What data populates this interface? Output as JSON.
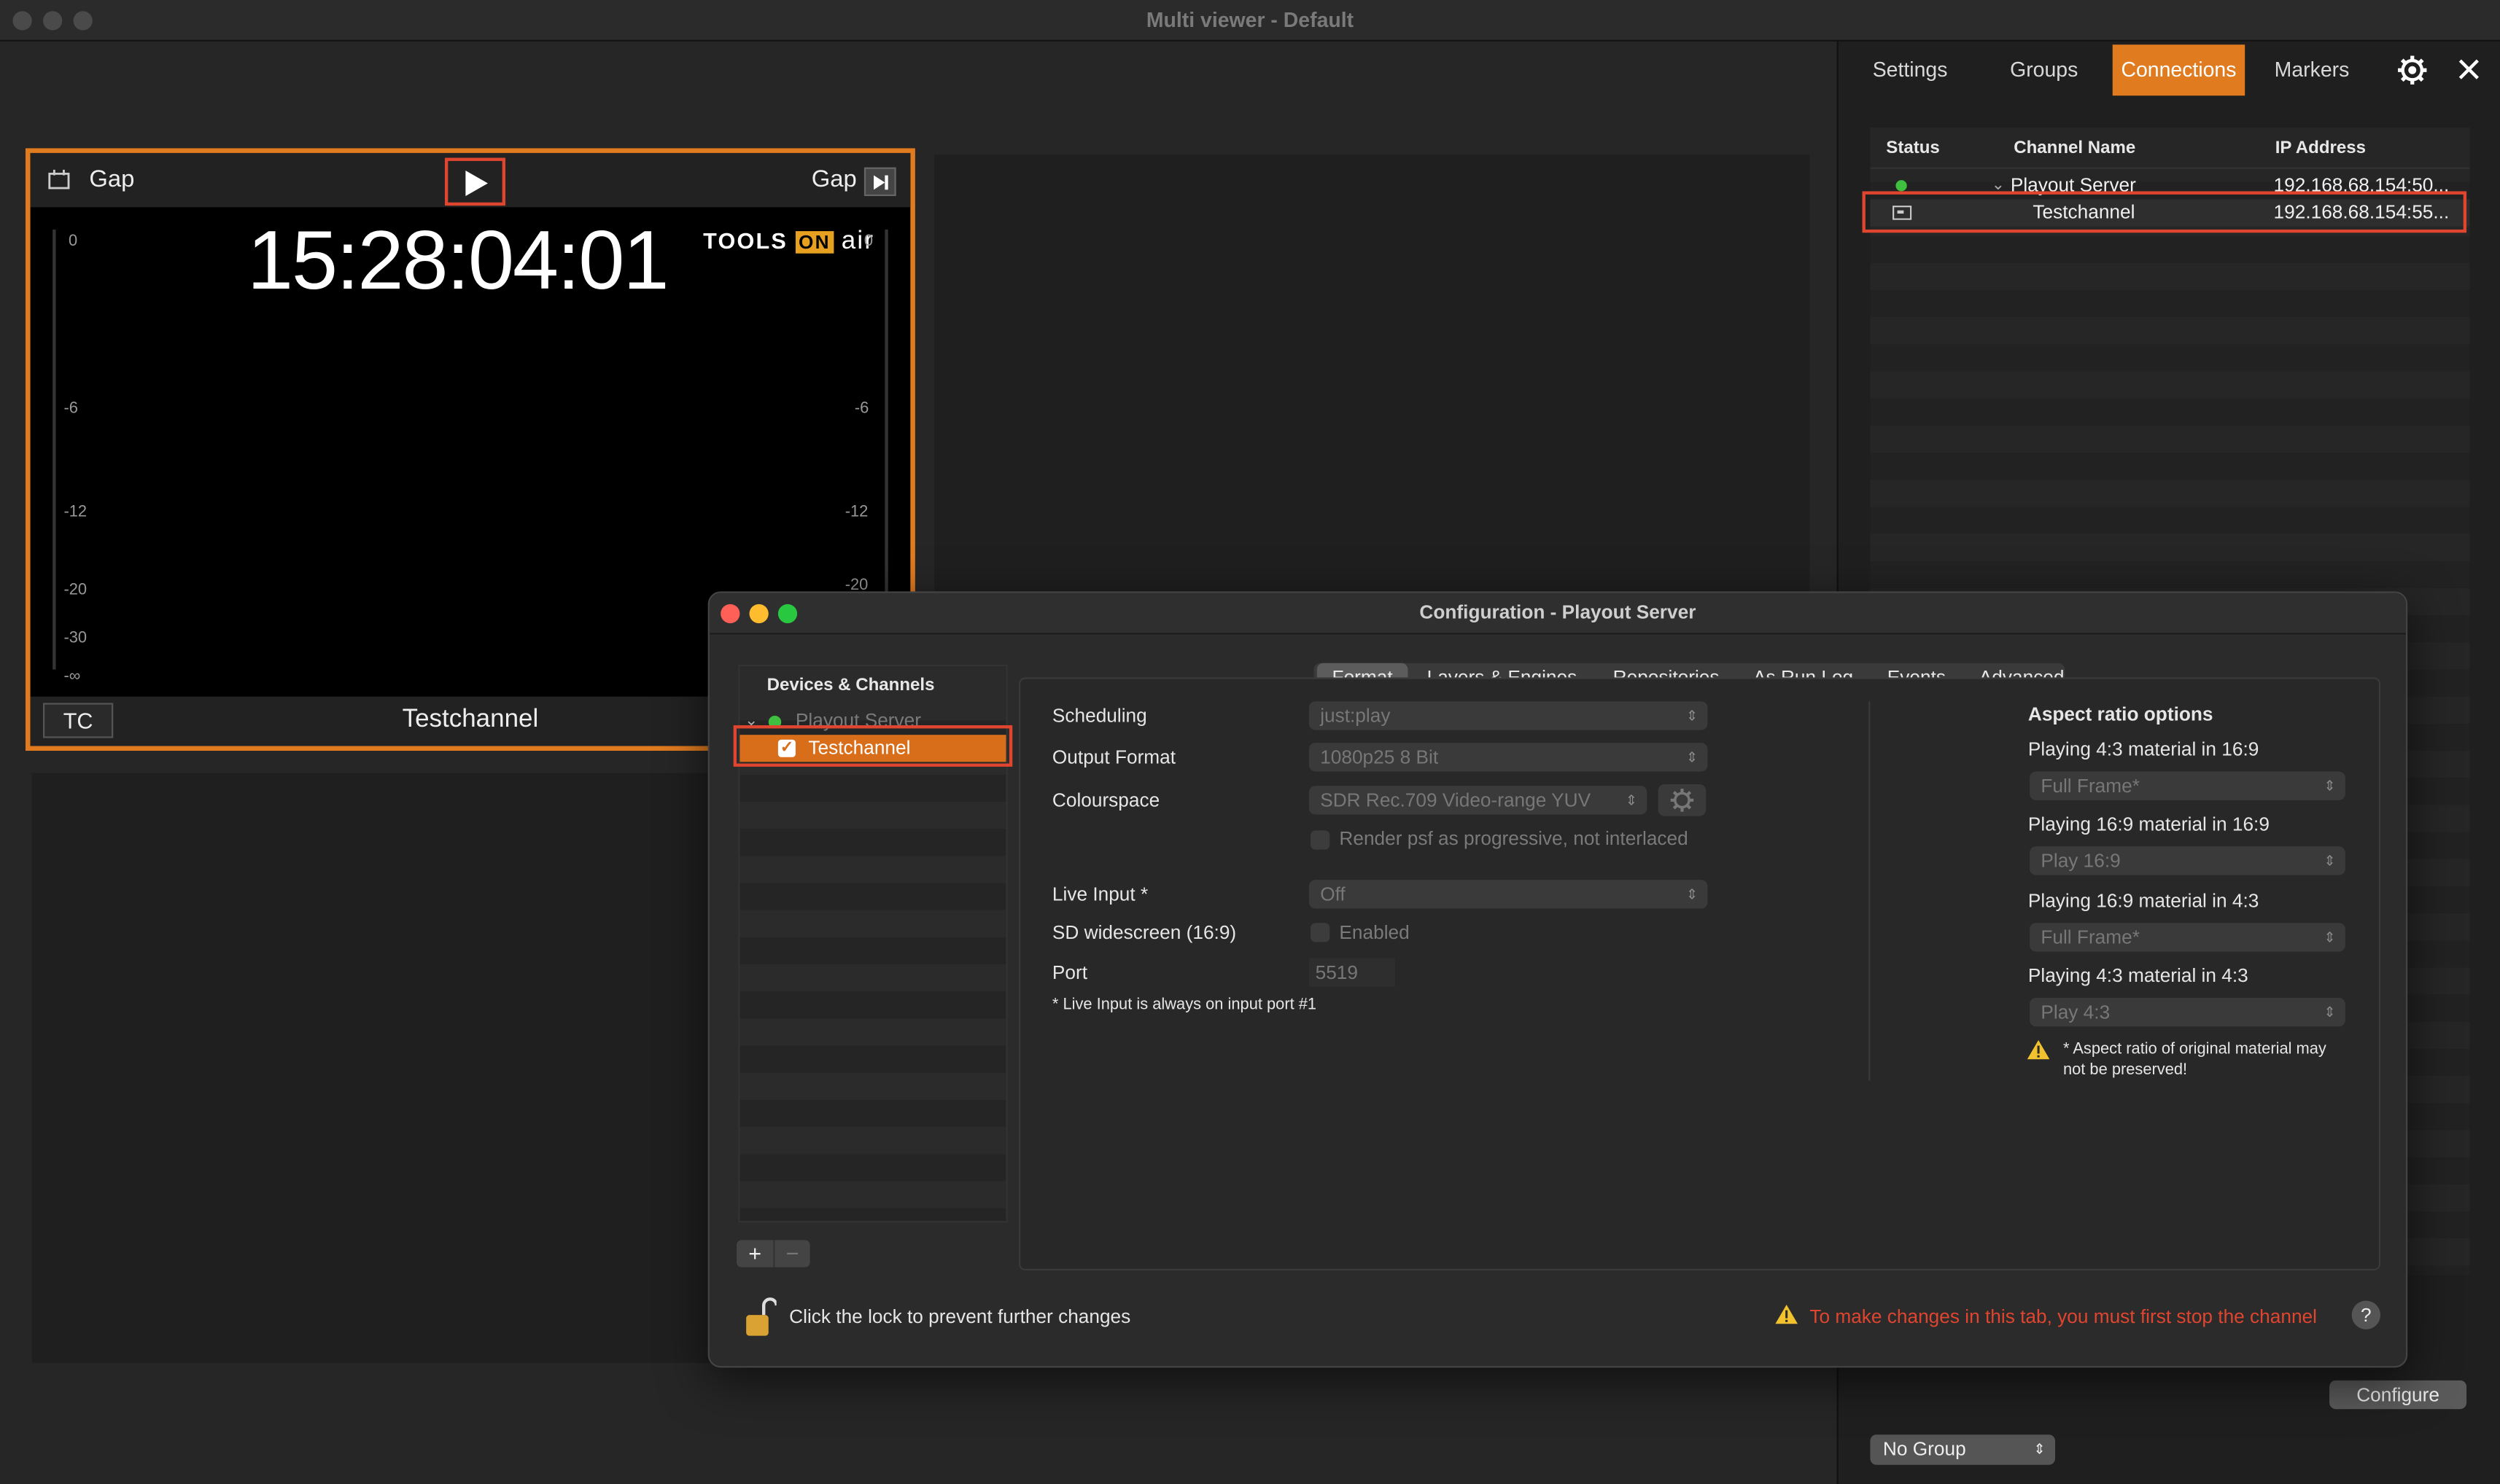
{
  "window": {
    "title": "Multi viewer - Default"
  },
  "tile": {
    "left_label": "Gap",
    "right_label": "Gap",
    "timecode": "15:28:04:01",
    "logo_tools": "TOOLS",
    "logo_on": "ON",
    "logo_air": "air",
    "meter_left": [
      "0",
      "-6",
      "-12",
      "-20",
      "-30",
      "-∞"
    ],
    "meter_right": [
      "0",
      "-6",
      "-12",
      "-20"
    ],
    "tc_label": "TC",
    "channel_name": "Testchannel"
  },
  "right_panel": {
    "tabs": [
      "Settings",
      "Groups",
      "Connections",
      "Markers"
    ],
    "active_tab": "Connections",
    "columns": [
      "Status",
      "Channel Name",
      "IP Address"
    ],
    "rows": [
      {
        "name": "Playout Server",
        "ip": "192.168.68.154:50...",
        "status_color": "#3fbf3f"
      },
      {
        "name": "Testchannel",
        "ip": "192.168.68.154:55..."
      }
    ],
    "configure_label": "Configure",
    "group_select": "No Group"
  },
  "dialog": {
    "title": "Configuration - Playout Server",
    "devices_header": "Devices & Channels",
    "device_parent": "Playout Server",
    "device_child": "Testchannel",
    "tabs": [
      "Format",
      "Layers & Engines",
      "Repositories",
      "As Run Log",
      "Events",
      "Advanced"
    ],
    "active_tab": "Format",
    "fields": {
      "scheduling_label": "Scheduling",
      "scheduling_value": "just:play",
      "output_label": "Output Format",
      "output_value": "1080p25 8 Bit",
      "colour_label": "Colourspace",
      "colour_value": "SDR Rec.709 Video-range YUV",
      "psf_label": "Render psf as progressive, not interlaced",
      "live_label": "Live Input *",
      "live_value": "Off",
      "sdwide_label": "SD widescreen (16:9)",
      "sdwide_value": "Enabled",
      "port_label": "Port",
      "port_value": "5519",
      "live_note": "* Live Input is always on input port #1"
    },
    "aspect": {
      "title": "Aspect ratio options",
      "items": [
        {
          "label": "Playing 4:3 material in 16:9",
          "value": "Full Frame*"
        },
        {
          "label": "Playing 16:9 material in 16:9",
          "value": "Play 16:9"
        },
        {
          "label": "Playing 16:9 material in 4:3",
          "value": "Full Frame*"
        },
        {
          "label": "Playing 4:3 material in 4:3",
          "value": "Play 4:3"
        }
      ],
      "warning": "* Aspect ratio of original material may not be preserved!"
    },
    "add_label": "+",
    "remove_label": "−",
    "lock_text": "Click the lock to prevent further changes",
    "stop_warning": "To make changes in this tab, you must first stop the channel",
    "help_label": "?"
  },
  "colors": {
    "accent": "#e07b20",
    "highlight_box": "#e0452f",
    "warning_text": "#e0452f"
  }
}
